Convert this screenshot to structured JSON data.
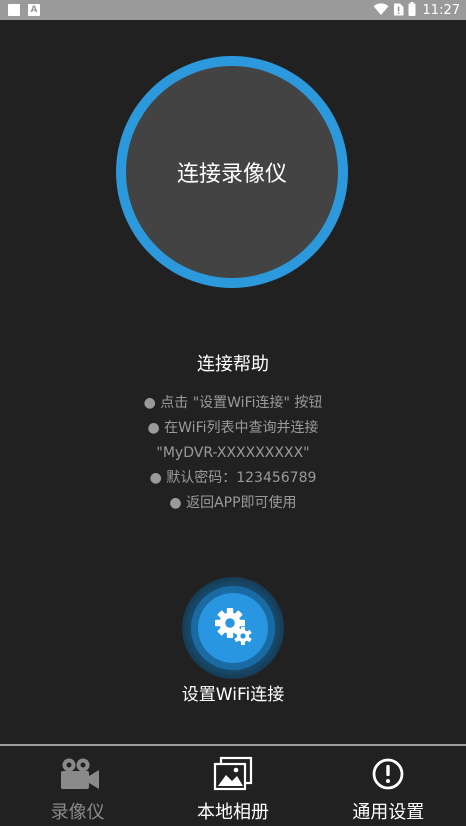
{
  "status_bar": {
    "time": "11:27",
    "a_badge": "A"
  },
  "main": {
    "connect_button_label": "连接录像仪",
    "help_title": "连接帮助",
    "help_lines": [
      "● 点击 \"设置WiFi连接\" 按钮",
      "● 在WiFi列表中查询并连接",
      "\"MyDVR-XXXXXXXXX\"",
      "● 默认密码：123456789",
      "● 返回APP即可使用"
    ],
    "wifi_settings_label": "设置WiFi连接"
  },
  "bottom_nav": {
    "items": [
      {
        "label": "录像仪",
        "icon": "video-camera-icon",
        "active": true
      },
      {
        "label": "本地相册",
        "icon": "photo-album-icon",
        "active": false
      },
      {
        "label": "通用设置",
        "icon": "info-circle-icon",
        "active": false
      }
    ]
  },
  "colors": {
    "background": "#212121",
    "accent_blue": "#2c99dd",
    "circle_gray": "#434343",
    "help_text": "#9a9a9a",
    "inactive_nav": "#8a8a8a"
  }
}
